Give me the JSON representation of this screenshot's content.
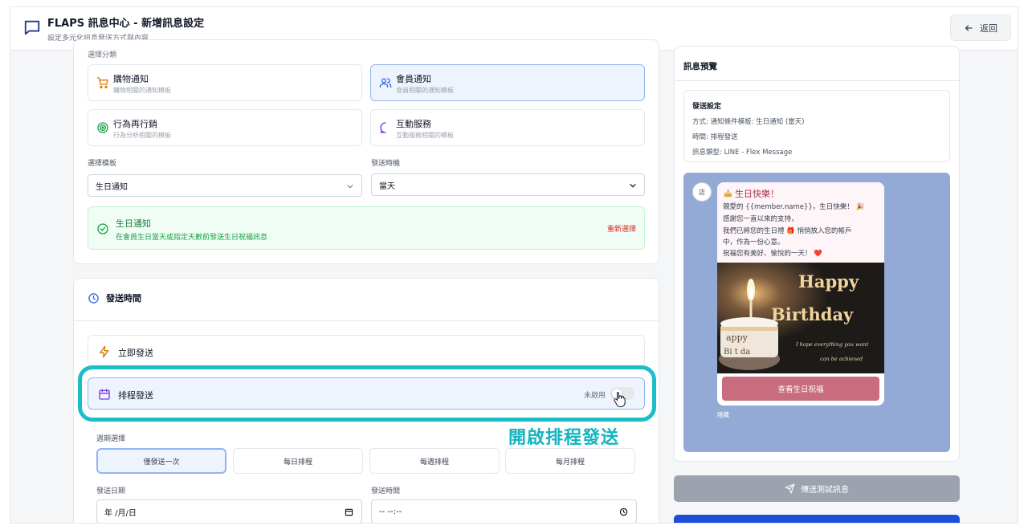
{
  "header": {
    "title": "FLAPS 訊息中心 - 新增訊息設定",
    "subtitle": "設定多元化訊息發送方式與內容",
    "back_label": "返回"
  },
  "categories_section": {
    "label": "選擇分類",
    "items": [
      {
        "name": "購物通知",
        "desc": "購物相關的通知模板",
        "icon": "shopping-cart-icon",
        "selected": false
      },
      {
        "name": "會員通知",
        "desc": "會員相關的通知模板",
        "icon": "users-icon",
        "selected": true
      },
      {
        "name": "行為再行銷",
        "desc": "行為分析相關的模板",
        "icon": "target-icon",
        "selected": false
      },
      {
        "name": "互動服務",
        "desc": "互動服務相關的模板",
        "icon": "chat-bubble-icon",
        "selected": false
      }
    ]
  },
  "template_select": {
    "label": "選擇模板",
    "value": "生日通知"
  },
  "timing_select": {
    "label": "發送時機",
    "value": "當天"
  },
  "template_notice": {
    "name": "生日通知",
    "desc": "在會員生日當天或指定天數前發送生日祝福訊息",
    "reselect": "重新選擇"
  },
  "send_time": {
    "title": "發送時間",
    "immediate_label": "立即發送",
    "schedule_label": "排程發送",
    "toggle_status": "未啟用",
    "toggle_on": false
  },
  "annotation": "開啟排程發送",
  "frequency": {
    "label": "週期選擇",
    "options": [
      "僅發送一次",
      "每日排程",
      "每週排程",
      "每月排程"
    ],
    "active_index": 0
  },
  "send_date": {
    "label": "發送日期",
    "value": "年 /月/日"
  },
  "send_clock": {
    "label": "發送時間",
    "value": "-- --:--"
  },
  "preview": {
    "title": "訊息預覽",
    "settings_title": "發送設定",
    "method": "方式: 通知條件模板: 生日通知 (當天)",
    "time": "時間: 排程發送",
    "type": "訊息類型: LINE - Flex Message",
    "avatar": "店",
    "bubble_title": "生日快樂！",
    "bubble_lines": [
      "親愛的 {{member.name}}，生日快樂！ 🎉",
      "感謝您一直以來的支持，",
      "我們已將您的生日禮 🎁 悄悄放入您的帳戶",
      "中，作為一份心意。",
      "祝福您有美好、愉悅的一天！ ❤️"
    ],
    "photo_text_1": "Happy",
    "photo_text_2": "Birthday",
    "photo_text_3": "I hope everything you want",
    "photo_text_4": "can be achieved",
    "cake_text_1": "appy",
    "cake_text_2": "Bi  t  da",
    "cta_label": "查看生日祝福",
    "close_label": "隱藏",
    "send_test_label": "傳送測試訊息"
  },
  "colors": {
    "accent": "#1bbec7",
    "primary_blue": "#1d4ed8",
    "chat_bg": "#93a9d6",
    "cta": "#c96c7e"
  }
}
